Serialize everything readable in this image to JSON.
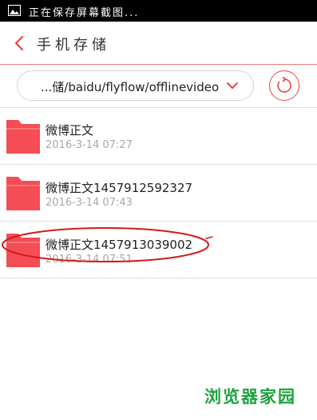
{
  "status_bar": {
    "text": "正在保存屏幕截图...",
    "icon": "image-icon"
  },
  "header": {
    "title": "手机存储",
    "back_icon": "chevron-left-icon"
  },
  "path_bar": {
    "path": "...储/baidu/flyflow/offlinevideo",
    "dropdown_icon": "chevron-down-icon",
    "refresh_icon": "refresh-icon"
  },
  "files": [
    {
      "name": "微博正文",
      "date": "2016-3-14 07:27"
    },
    {
      "name": "微博正文1457912592327",
      "date": "2016-3-14 07:43"
    },
    {
      "name": "微博正文1457913039002",
      "date": "2016-3-14 07:51"
    }
  ],
  "watermark": "浏览器家园",
  "colors": {
    "accent": "#e34848",
    "folder": "#f44d55",
    "annotation": "#d31b1b",
    "watermark": "#1ca23f"
  }
}
